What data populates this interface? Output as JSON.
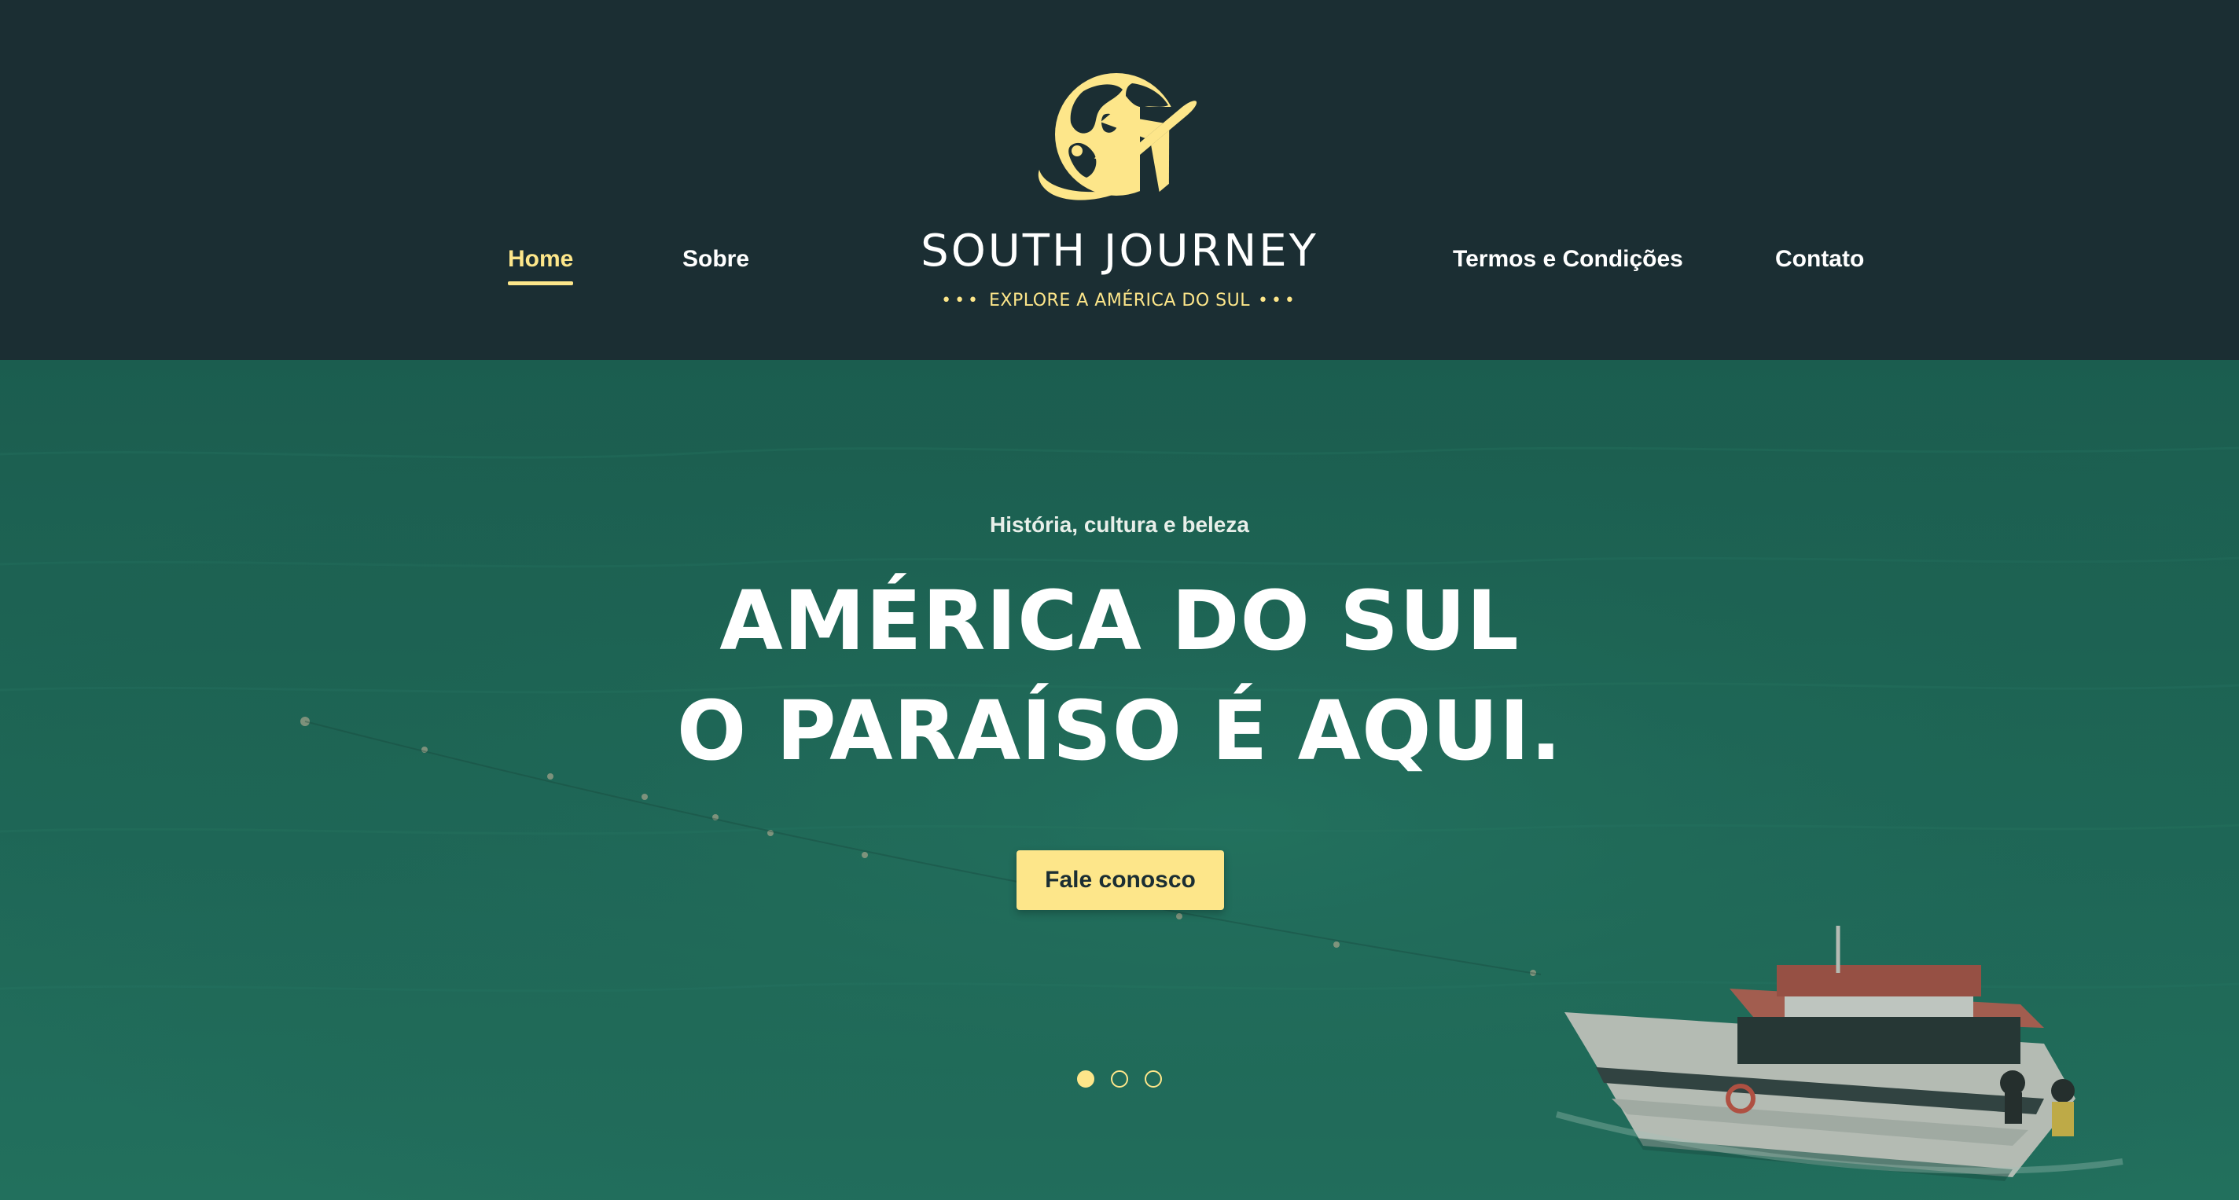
{
  "brand": {
    "name": "SOUTH JOURNEY",
    "tagline": "EXPLORE A AMÉRICA DO SUL",
    "tagline_dots": "•••",
    "logo_icon": "globe-airplane-icon",
    "accent_color": "#fde68a",
    "header_color": "#1b2e33"
  },
  "nav": {
    "items": [
      {
        "label": "Home",
        "active": true
      },
      {
        "label": "Sobre",
        "active": false
      },
      {
        "label": "Termos e Condições",
        "active": false
      },
      {
        "label": "Contato",
        "active": false
      }
    ]
  },
  "hero": {
    "subtitle": "História, cultura e beleza",
    "title_line1": "AMÉRICA DO SUL",
    "title_line2": "O PARAÍSO É AQUI.",
    "cta_label": "Fale conosco",
    "background": "ocean-with-boat-photo",
    "slides": {
      "count": 3,
      "active_index": 0
    }
  }
}
